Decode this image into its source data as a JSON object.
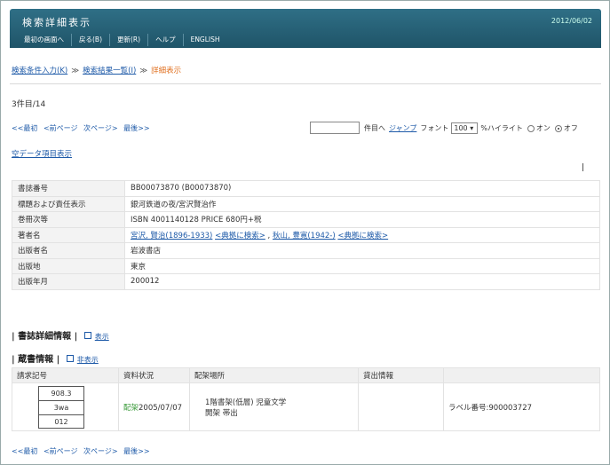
{
  "header": {
    "title": "検索詳細表示",
    "date": "2012/06/02",
    "menu": [
      "最初の画面へ",
      "戻る(B)",
      "更新(R)",
      "ヘルプ",
      "ENGLISH"
    ]
  },
  "breadcrumb": {
    "items": [
      "検索条件入力(K)",
      "検索結果一覧(I)"
    ],
    "separator": "≫",
    "current": "詳細表示"
  },
  "count": "3件目/14",
  "pager": {
    "first": "<<最初",
    "prev": "<前ページ",
    "next": "次ページ>",
    "last": "最後>>"
  },
  "controls": {
    "page_suffix": "件目へ",
    "jump": "ジャンプ",
    "font": "フォント",
    "font_size": "100",
    "percent": "%",
    "highlight": "ハイライト",
    "on": "オン",
    "off": "オフ",
    "highlight_selected": "off"
  },
  "empty_fields_link": "空データ項目表示",
  "detail": {
    "rows": [
      {
        "key": "書誌番号",
        "value": "BB00073870 (B00073870)"
      },
      {
        "key": "標題および責任表示",
        "value": "銀河鉄道の夜/宮沢賢治作"
      },
      {
        "key": "巻冊次等",
        "value": "ISBN 4001140128  PRICE 680円+税"
      },
      {
        "key": "著者名",
        "value_links": [
          "宮沢, 賢治(1896-1933)",
          "<典拠に検索>",
          "秋山, 豊寛(1942-)",
          "<典拠に検索>"
        ],
        "value_seps": [
          " ",
          " , ",
          " "
        ]
      },
      {
        "key": "出版者名",
        "value": "岩波書店"
      },
      {
        "key": "出版地",
        "value": "東京"
      },
      {
        "key": "出版年月",
        "value": "200012"
      }
    ]
  },
  "sections": {
    "bib_detail": {
      "label": "書誌詳細情報",
      "toggle": "表示"
    },
    "holdings": {
      "label": "蔵書情報",
      "toggle": "非表示"
    }
  },
  "holdings": {
    "headers": [
      "請求記号",
      "資料状況",
      "配架場所",
      "貸出情報",
      ""
    ],
    "row": {
      "call_number": [
        "908.3",
        "3wa",
        "012"
      ],
      "status_label": "配架",
      "status_date": "2005/07/07",
      "location_line1": "1階書架(低層) 児童文学",
      "location_line2": "開架 帯出",
      "loan_info": "",
      "label_number": "ラベル番号:900003727"
    }
  },
  "colors": {
    "header_bg": "#2f6f86",
    "link": "#1e5aa8",
    "current_crumb": "#e07020",
    "status_green": "#3a9a3a"
  }
}
